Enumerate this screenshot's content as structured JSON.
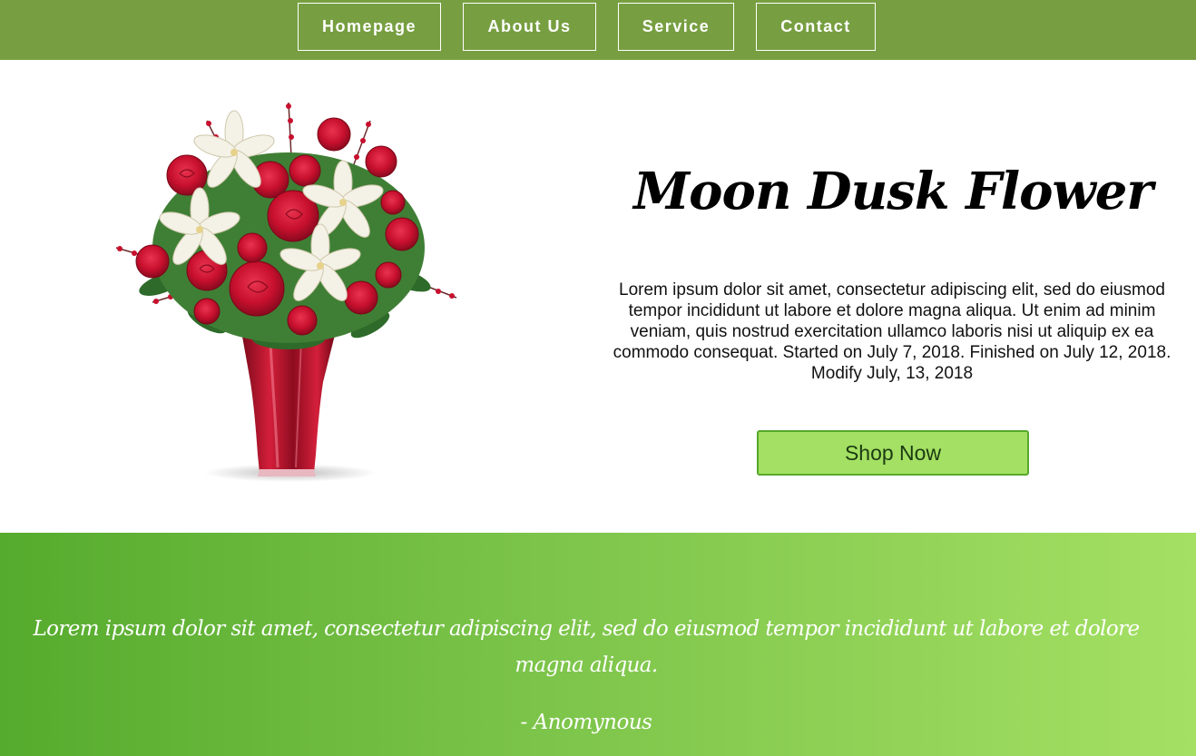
{
  "nav": {
    "items": [
      {
        "label": "Homepage"
      },
      {
        "label": "About Us"
      },
      {
        "label": "Service"
      },
      {
        "label": "Contact"
      }
    ]
  },
  "hero": {
    "title": "Moon Dusk Flower",
    "description": "Lorem ipsum dolor sit amet, consectetur adipiscing elit, sed do eiusmod tempor incididunt ut labore et dolore magna aliqua. Ut enim ad minim veniam, quis nostrud exercitation ullamco laboris nisi ut aliquip ex ea commodo consequat. Started on July 7, 2018. Finished on July 12, 2018. Modify July, 13, 2018",
    "button_label": "Shop Now"
  },
  "quote": {
    "text": "Lorem ipsum dolor sit amet, consectetur adipiscing elit, sed do eiusmod tempor incididunt ut labore et dolore magna aliqua.",
    "author": "- Anomynous"
  },
  "colors": {
    "nav_bg": "#779f41",
    "button_bg": "#a4e063",
    "button_border": "#56a82c",
    "gradient_start": "#55ab2d",
    "gradient_end": "#a4e063",
    "rose": "#c8102e",
    "lily": "#f4f1e6",
    "vase": "#b3122a"
  },
  "icons": {
    "product_image": "flower-bouquet-in-red-vase"
  }
}
